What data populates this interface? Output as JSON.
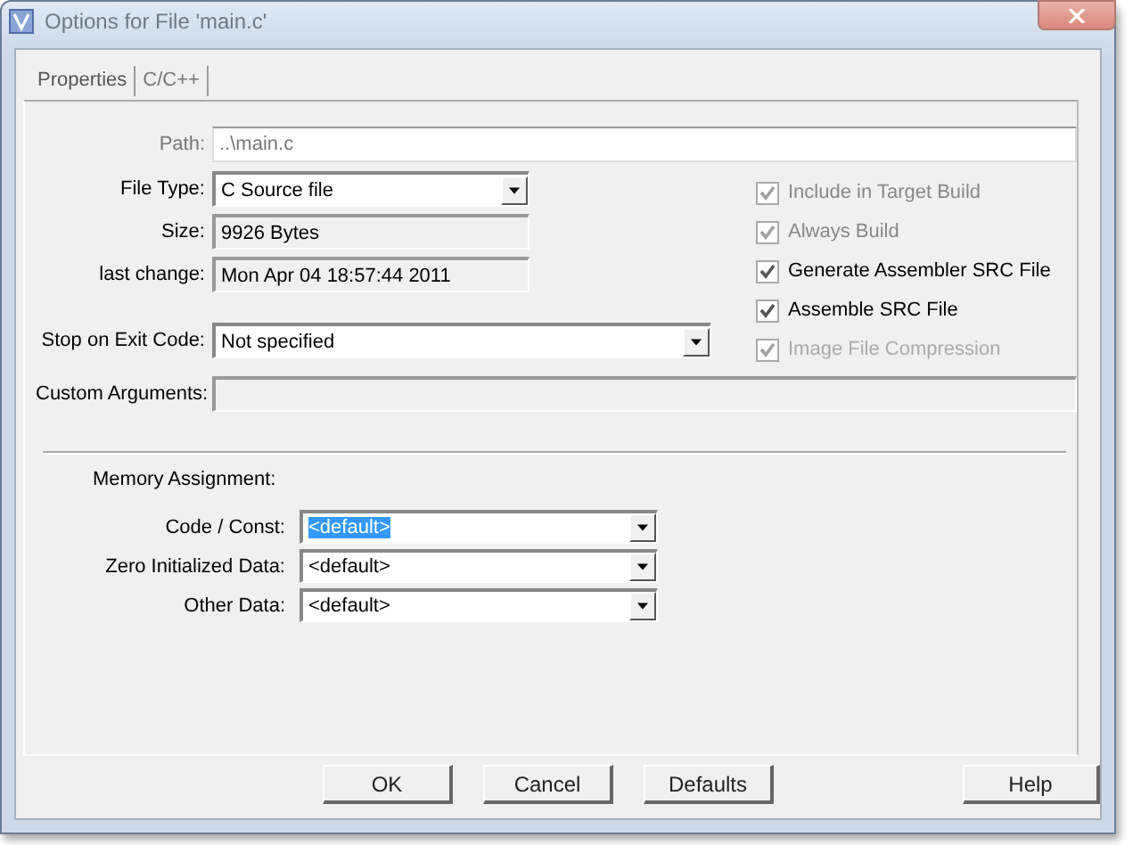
{
  "window": {
    "title": "Options for File 'main.c'"
  },
  "tabs": [
    {
      "label": "Properties",
      "selected": true
    },
    {
      "label": "C/C++",
      "selected": false
    }
  ],
  "path": {
    "label": "Path:",
    "value": "..\\main.c",
    "kind": "greyed"
  },
  "file_info": [
    {
      "label": "File Type:",
      "value": "C Source file",
      "kind": "dropdown"
    },
    {
      "label": "Size:",
      "value": "9926 Bytes",
      "kind": "readonly"
    },
    {
      "label": "last change:",
      "value": "Mon Apr 04 18:57:44 2011",
      "kind": "readonly"
    }
  ],
  "stop_on_exit_code": {
    "label": "Stop on Exit Code:",
    "value": "Not specified",
    "kind": "dropdown"
  },
  "custom_arguments": {
    "label": "Custom Arguments:",
    "kind": "disabled"
  },
  "checkboxes": [
    {
      "label": "Include in Target Build",
      "checked": true,
      "disabled": true
    },
    {
      "label": "Always Build",
      "checked": true,
      "disabled": true
    },
    {
      "label": "Generate Assembler SRC File",
      "checked": true,
      "disabled": false
    },
    {
      "label": "Assemble SRC File",
      "checked": true,
      "disabled": false
    },
    {
      "label": "Image File Compression",
      "checked": true,
      "disabled": true
    }
  ],
  "memory_assignment": {
    "label": "Memory Assignment:",
    "rows": [
      {
        "label": "Code / Const:",
        "value": "<default>",
        "selected": true
      },
      {
        "label": "Zero Initialized Data:",
        "value": "<default>",
        "selected": false
      },
      {
        "label": "Other Data:",
        "value": "<default>",
        "selected": false
      }
    ]
  },
  "buttons": [
    "OK",
    "Cancel",
    "Defaults",
    "Help"
  ]
}
